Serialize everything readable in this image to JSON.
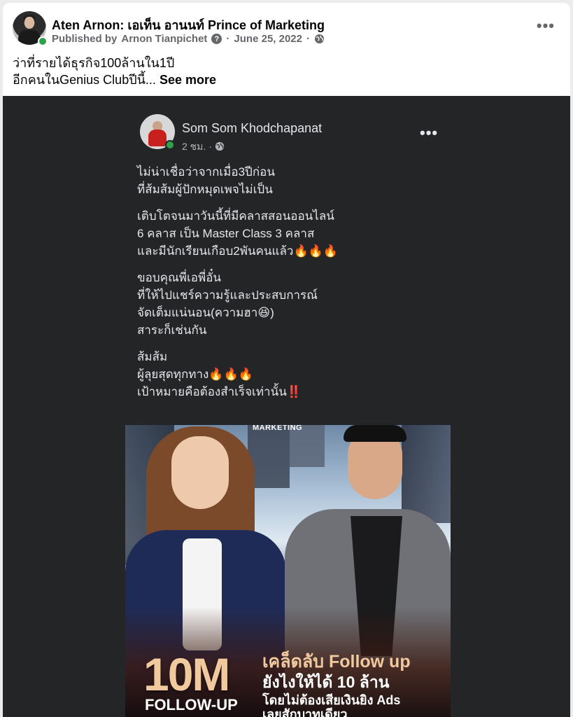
{
  "post": {
    "author": "Aten Arnon: เอเท็น อานนท์ Prince of Marketing",
    "published_by_prefix": "Published by",
    "publisher": "Arnon Tianpichet",
    "date": "June 25, 2022",
    "text_line1": "ว่าที่รายได้ธุรกิจ100ล้านใน1ปี",
    "text_line2": "อีกคนในGenius Clubปีนี้...",
    "see_more": "See more",
    "more_icon": "more-horizontal-icon"
  },
  "embedded_post": {
    "author": "Som Som Khodchapanat",
    "time": "2 ชม.",
    "paragraphs": [
      "ไม่น่าเชื่อว่าจากเมื่อ3ปีก่อน\nที่ส้มส้มผู้ปักหมุดเพจไม่เป็น",
      "เติบโตจนมาวันนี้ที่มีคลาสสอนออนไลน์\n6 คลาส เป็น Master Class 3 คลาส\nและมีนักเรียนเกือบ2พันคนแล้ว🔥🔥🔥",
      "ขอบคุณพี่เอพี่อั๋น\nที่ให้ไปแชร์ความรู้และประสบการณ์\nจัดเต็มแน่นอน(ความฮา😆)\nสาระก็เช่นกัน",
      "ส้มส้ม\nผู้ลุยสุดทุกทาง🔥🔥🔥\nเป้าหมายคือต้องสำเร็จเท่านั้น‼️"
    ]
  },
  "poster": {
    "brand": "MARKETING",
    "big_number": "10M",
    "follow_up": "FOLLOW-UP",
    "headline1": "เคล็ดลับ Follow up",
    "headline2": "ยังไงให้ได้ 10 ล้าน",
    "subline1": "โดยไม่ต้องเสียเงินยิง Ads",
    "subline2": "เลยสักบาทเดียว"
  },
  "colors": {
    "online": "#31a24c",
    "dark_bg": "#242526",
    "poster_gold": "#f1c99f"
  }
}
